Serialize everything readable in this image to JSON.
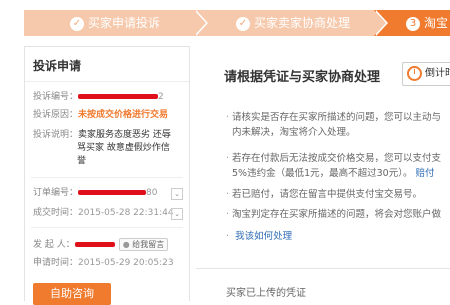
{
  "steps": [
    {
      "label": "买家申请投诉",
      "state": "done"
    },
    {
      "label": "买家卖家协商处理",
      "state": "done"
    },
    {
      "label": "淘宝",
      "number": "3",
      "state": "current"
    }
  ],
  "left": {
    "title": "投诉申请",
    "complaint_no_label": "投诉编号：",
    "complaint_no_tail": "2",
    "reason_label": "投诉原因：",
    "reason_value": "未按成交价格进行交易",
    "desc_label": "投诉说明：",
    "desc_value_1": "卖家服务态度恶劣 还辱",
    "desc_value_2": "骂买家 故意虚假炒作信",
    "desc_value_3": "誉",
    "order_no_label": "订单编号：",
    "order_no_tail": "80",
    "deal_time_label": "成交时间：",
    "deal_time_value": "2015-05-28 22:31:44",
    "initiator_label": "发 起 人：",
    "initiator_tag": "给我留言",
    "apply_time_label": "申请时间：",
    "apply_time_value": "2015-05-29 20:05:23",
    "consult_button": "自助咨询"
  },
  "right": {
    "title": "请根据凭证与买家协商处理",
    "countdown": "倒计时",
    "bullets": [
      "请核实是否存在买家所描述的问题，您可以主动与",
      "内未解决，淘宝将介入处理。",
      "若存在付款后无法按成交价格交易，您可以支付支",
      "5%违约金（最低1元，最高不超过30元）。",
      "若已赔付，请您在留言中提供支付宝交易号。",
      "淘宝判定存在买家所描述的问题，将会对您账户做",
      "我该如何处理"
    ],
    "pay_link": "赔付",
    "bottom_text": "买家已上传的凭证"
  },
  "colors": {
    "accent": "#f07a2e",
    "step_done": "#f6c9ad",
    "redact": "#e0101a",
    "link": "#2f6eb5"
  }
}
